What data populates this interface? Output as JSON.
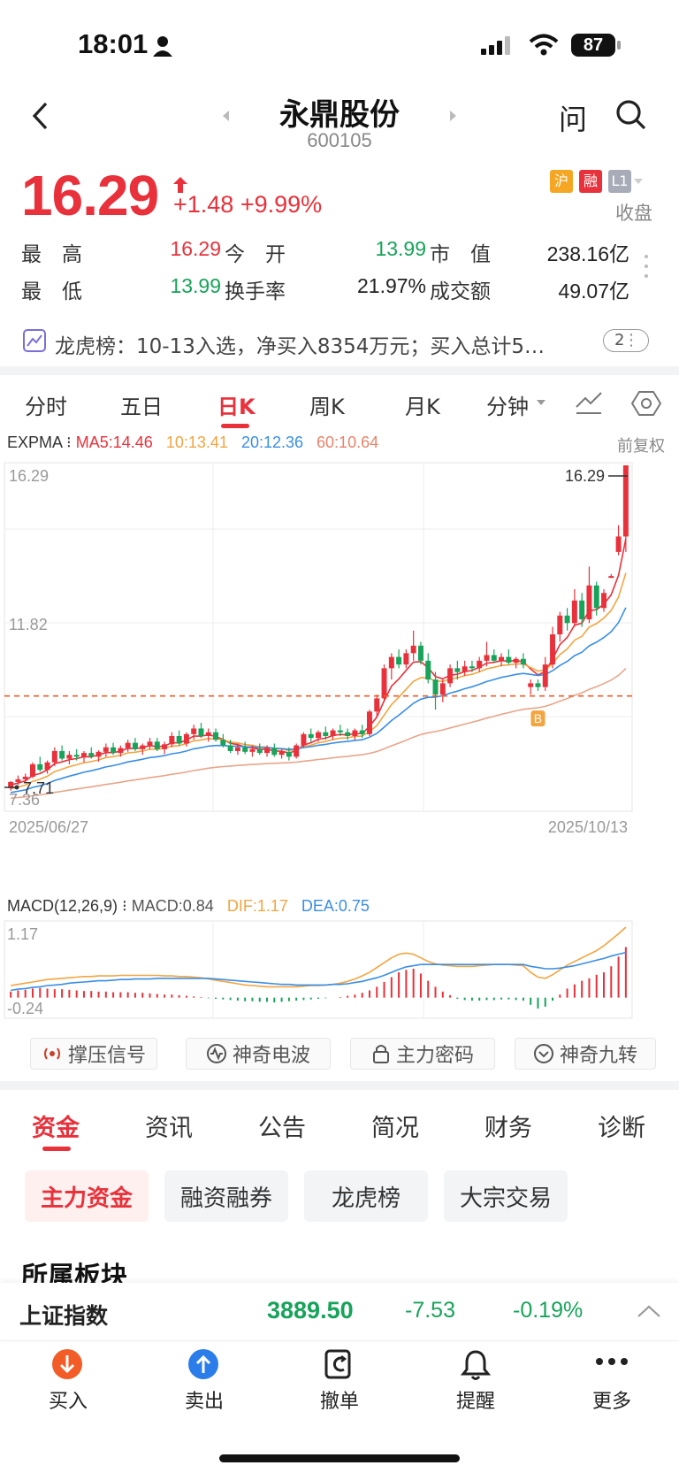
{
  "status": {
    "time": "18:01",
    "battery": "87"
  },
  "header": {
    "title": "永鼎股份",
    "code": "600105",
    "back_icon": "chevron-left-icon",
    "search_icon": "search-icon",
    "ask_label": "问"
  },
  "quote": {
    "price": "16.29",
    "change": "+1.48",
    "change_pct": "+9.99%",
    "badge_sh": "沪",
    "badge_rong": "融",
    "badge_l1": "L1",
    "status": "收盘"
  },
  "stats": [
    {
      "label": "最　高",
      "value": "16.29",
      "color": "red"
    },
    {
      "label": "今　开",
      "value": "13.99",
      "color": "grn"
    },
    {
      "label": "市　值",
      "value": "238.16亿",
      "color": "dark"
    },
    {
      "label": "最　低",
      "value": "13.99",
      "color": "grn"
    },
    {
      "label": "换手率",
      "value": "21.97%",
      "color": "dark"
    },
    {
      "label": "成交额",
      "value": "49.07亿",
      "color": "dark"
    }
  ],
  "lhb": {
    "text": "龙虎榜：10-13入选，净买入8354万元；买入总计5…",
    "count": "2"
  },
  "tabs": [
    "分时",
    "五日",
    "日K",
    "周K",
    "月K",
    "分钟"
  ],
  "active_tab": "日K",
  "expma": {
    "label": "EXPMA",
    "ma5": "MA5:14.46",
    "ma10": "10:13.41",
    "ma20": "20:12.36",
    "ma60": "60:10.64",
    "adjust": "前复权"
  },
  "macd": {
    "label": "MACD(12,26,9)",
    "macd": "MACD:0.84",
    "dif": "DIF:1.17",
    "dea": "DEA:0.75"
  },
  "chart_data": {
    "type": "candlestick",
    "y_axis_labels": [
      "16.29",
      "11.82",
      "7.36"
    ],
    "x_axis_labels": [
      "2025/06/27",
      "2025/10/13"
    ],
    "last_price_label": "16.29",
    "low_label": "7.71",
    "buy_marker": "B",
    "macd_axis_labels": [
      "1.17",
      "-0.24"
    ],
    "ylim": [
      7.36,
      16.29
    ],
    "macd_ylim": [
      -0.24,
      1.17
    ],
    "candles": [
      [
        7.72,
        7.9,
        7.65,
        7.88
      ],
      [
        7.88,
        8.05,
        7.8,
        7.95
      ],
      [
        7.95,
        8.1,
        7.85,
        8.02
      ],
      [
        8.02,
        8.4,
        7.98,
        8.35
      ],
      [
        8.35,
        8.55,
        8.15,
        8.2
      ],
      [
        8.2,
        8.45,
        8.1,
        8.4
      ],
      [
        8.4,
        8.8,
        8.3,
        8.7
      ],
      [
        8.7,
        8.85,
        8.45,
        8.5
      ],
      [
        8.5,
        8.7,
        8.35,
        8.6
      ],
      [
        8.6,
        8.75,
        8.45,
        8.55
      ],
      [
        8.55,
        8.7,
        8.4,
        8.65
      ],
      [
        8.65,
        8.8,
        8.5,
        8.55
      ],
      [
        8.55,
        8.72,
        8.42,
        8.68
      ],
      [
        8.68,
        8.9,
        8.55,
        8.8
      ],
      [
        8.8,
        8.92,
        8.6,
        8.65
      ],
      [
        8.65,
        8.85,
        8.55,
        8.78
      ],
      [
        8.78,
        9.0,
        8.68,
        8.92
      ],
      [
        8.92,
        9.05,
        8.7,
        8.75
      ],
      [
        8.75,
        8.9,
        8.6,
        8.85
      ],
      [
        8.85,
        9.05,
        8.75,
        8.95
      ],
      [
        8.95,
        9.05,
        8.7,
        8.75
      ],
      [
        8.75,
        8.95,
        8.62,
        8.88
      ],
      [
        8.88,
        9.2,
        8.8,
        9.1
      ],
      [
        9.1,
        9.25,
        8.85,
        8.9
      ],
      [
        8.9,
        9.2,
        8.82,
        9.15
      ],
      [
        9.15,
        9.4,
        9.0,
        9.3
      ],
      [
        9.3,
        9.45,
        9.05,
        9.1
      ],
      [
        9.1,
        9.3,
        8.95,
        9.2
      ],
      [
        9.2,
        9.3,
        8.95,
        9.0
      ],
      [
        9.0,
        9.15,
        8.8,
        8.85
      ],
      [
        8.85,
        9.0,
        8.65,
        8.7
      ],
      [
        8.7,
        8.9,
        8.6,
        8.8
      ],
      [
        8.8,
        8.95,
        8.62,
        8.68
      ],
      [
        8.68,
        8.85,
        8.55,
        8.75
      ],
      [
        8.75,
        8.9,
        8.6,
        8.65
      ],
      [
        8.65,
        8.85,
        8.55,
        8.78
      ],
      [
        8.78,
        8.9,
        8.55,
        8.6
      ],
      [
        8.6,
        8.75,
        8.5,
        8.68
      ],
      [
        8.68,
        8.8,
        8.45,
        8.55
      ],
      [
        8.55,
        8.9,
        8.5,
        8.85
      ],
      [
        8.85,
        9.2,
        8.8,
        9.15
      ],
      [
        9.15,
        9.3,
        8.95,
        9.05
      ],
      [
        9.05,
        9.25,
        8.95,
        9.2
      ],
      [
        9.2,
        9.35,
        9.0,
        9.1
      ],
      [
        9.1,
        9.3,
        9.0,
        9.25
      ],
      [
        9.25,
        9.4,
        9.1,
        9.2
      ],
      [
        9.2,
        9.3,
        9.0,
        9.1
      ],
      [
        9.1,
        9.3,
        9.0,
        9.25
      ],
      [
        9.25,
        9.4,
        9.05,
        9.15
      ],
      [
        9.15,
        9.8,
        9.1,
        9.75
      ],
      [
        9.75,
        10.2,
        9.6,
        10.1
      ],
      [
        10.1,
        11.0,
        10.0,
        10.9
      ],
      [
        10.9,
        11.3,
        10.6,
        11.2
      ],
      [
        11.2,
        11.4,
        10.9,
        11.0
      ],
      [
        11.0,
        11.4,
        10.9,
        11.3
      ],
      [
        11.3,
        11.9,
        11.1,
        11.5
      ],
      [
        11.5,
        11.6,
        11.0,
        11.1
      ],
      [
        11.1,
        11.3,
        10.5,
        10.6
      ],
      [
        10.6,
        10.8,
        9.8,
        10.2
      ],
      [
        10.2,
        10.6,
        10.0,
        10.5
      ],
      [
        10.5,
        11.0,
        10.4,
        10.9
      ],
      [
        10.9,
        11.1,
        10.6,
        10.8
      ],
      [
        10.8,
        11.1,
        10.7,
        10.95
      ],
      [
        10.95,
        11.1,
        10.8,
        10.9
      ],
      [
        10.9,
        11.2,
        10.8,
        11.1
      ],
      [
        11.1,
        11.6,
        10.95,
        11.25
      ],
      [
        11.25,
        11.4,
        11.05,
        11.1
      ],
      [
        11.1,
        11.3,
        10.95,
        11.2
      ],
      [
        11.2,
        11.4,
        11.0,
        11.05
      ],
      [
        11.05,
        11.2,
        10.9,
        11.15
      ],
      [
        11.15,
        11.3,
        10.9,
        11.0
      ],
      [
        10.4,
        10.6,
        10.2,
        10.5
      ],
      [
        10.5,
        10.6,
        10.3,
        10.4
      ],
      [
        10.4,
        11.2,
        10.3,
        11.0
      ],
      [
        11.0,
        12.0,
        10.9,
        11.8
      ],
      [
        11.8,
        12.4,
        11.6,
        12.3
      ],
      [
        12.3,
        12.5,
        11.9,
        12.1
      ],
      [
        12.1,
        13.0,
        12.0,
        12.7
      ],
      [
        12.7,
        12.9,
        12.0,
        12.2
      ],
      [
        12.2,
        13.6,
        12.1,
        13.1
      ],
      [
        13.1,
        13.2,
        12.3,
        12.5
      ],
      [
        12.5,
        13.0,
        12.4,
        12.9
      ],
      [
        13.3,
        13.4,
        13.3,
        13.35
      ],
      [
        13.99,
        14.7,
        13.9,
        14.4
      ],
      [
        14.4,
        16.29,
        13.99,
        16.29
      ]
    ],
    "macd_hist": [
      0.1,
      0.12,
      0.13,
      0.15,
      0.16,
      0.15,
      0.14,
      0.14,
      0.13,
      0.12,
      0.11,
      0.11,
      0.1,
      0.1,
      0.09,
      0.09,
      0.09,
      0.08,
      0.08,
      0.07,
      0.06,
      0.05,
      0.05,
      0.04,
      0.03,
      0.02,
      0.01,
      -0.01,
      -0.02,
      -0.03,
      -0.04,
      -0.05,
      -0.06,
      -0.06,
      -0.07,
      -0.07,
      -0.08,
      -0.07,
      -0.06,
      -0.05,
      -0.04,
      -0.03,
      -0.02,
      -0.01,
      0.0,
      0.01,
      0.03,
      0.05,
      0.08,
      0.12,
      0.18,
      0.26,
      0.34,
      0.42,
      0.46,
      0.48,
      0.4,
      0.28,
      0.18,
      0.1,
      0.04,
      -0.02,
      -0.04,
      -0.05,
      -0.05,
      -0.04,
      -0.04,
      -0.03,
      -0.03,
      -0.04,
      -0.05,
      -0.12,
      -0.18,
      -0.15,
      -0.05,
      0.05,
      0.15,
      0.22,
      0.28,
      0.32,
      0.38,
      0.42,
      0.52,
      0.68,
      0.84
    ],
    "dif_line": [
      0.2,
      0.22,
      0.24,
      0.26,
      0.28,
      0.3,
      0.31,
      0.32,
      0.33,
      0.34,
      0.35,
      0.35,
      0.36,
      0.36,
      0.36,
      0.37,
      0.37,
      0.37,
      0.37,
      0.37,
      0.37,
      0.36,
      0.36,
      0.35,
      0.35,
      0.34,
      0.33,
      0.31,
      0.29,
      0.27,
      0.25,
      0.23,
      0.21,
      0.2,
      0.19,
      0.18,
      0.18,
      0.18,
      0.18,
      0.18,
      0.19,
      0.2,
      0.2,
      0.21,
      0.22,
      0.24,
      0.27,
      0.31,
      0.36,
      0.42,
      0.5,
      0.58,
      0.66,
      0.72,
      0.74,
      0.72,
      0.66,
      0.6,
      0.56,
      0.54,
      0.53,
      0.52,
      0.52,
      0.52,
      0.53,
      0.54,
      0.55,
      0.55,
      0.55,
      0.54,
      0.53,
      0.42,
      0.34,
      0.32,
      0.38,
      0.46,
      0.54,
      0.6,
      0.66,
      0.72,
      0.78,
      0.86,
      0.96,
      1.06,
      1.17
    ],
    "dea_line": [
      0.12,
      0.14,
      0.15,
      0.17,
      0.18,
      0.2,
      0.21,
      0.22,
      0.24,
      0.25,
      0.26,
      0.27,
      0.28,
      0.28,
      0.29,
      0.3,
      0.3,
      0.31,
      0.31,
      0.31,
      0.32,
      0.32,
      0.32,
      0.32,
      0.32,
      0.32,
      0.32,
      0.32,
      0.31,
      0.3,
      0.29,
      0.28,
      0.27,
      0.26,
      0.25,
      0.24,
      0.23,
      0.22,
      0.22,
      0.21,
      0.21,
      0.21,
      0.21,
      0.21,
      0.22,
      0.22,
      0.23,
      0.25,
      0.27,
      0.3,
      0.33,
      0.37,
      0.42,
      0.47,
      0.51,
      0.53,
      0.55,
      0.55,
      0.55,
      0.55,
      0.55,
      0.55,
      0.55,
      0.55,
      0.55,
      0.55,
      0.55,
      0.55,
      0.55,
      0.55,
      0.55,
      0.52,
      0.5,
      0.48,
      0.48,
      0.49,
      0.51,
      0.53,
      0.56,
      0.59,
      0.62,
      0.65,
      0.69,
      0.72,
      0.75
    ]
  },
  "signals": [
    {
      "label": "撑压信号",
      "icon": "broadcast-icon"
    },
    {
      "label": "神奇电波",
      "icon": "wave-icon"
    },
    {
      "label": "主力密码",
      "icon": "lock-icon"
    },
    {
      "label": "神奇九转",
      "icon": "chevron-circle-icon"
    }
  ],
  "info_tabs": [
    "资金",
    "资讯",
    "公告",
    "简况",
    "财务",
    "诊断"
  ],
  "active_info_tab": "资金",
  "sub_chips": [
    "主力资金",
    "融资融券",
    "龙虎榜",
    "大宗交易"
  ],
  "section_title": "所属板块",
  "index_bar": {
    "name": "上证指数",
    "value": "3889.50",
    "change": "-7.53",
    "pct": "-0.19%"
  },
  "bottom_nav": [
    {
      "label": "买入",
      "icon": "buy-arrow-icon"
    },
    {
      "label": "卖出",
      "icon": "sell-arrow-icon"
    },
    {
      "label": "撤单",
      "icon": "cancel-order-icon"
    },
    {
      "label": "提醒",
      "icon": "bell-icon"
    },
    {
      "label": "更多",
      "icon": "more-dots-icon"
    }
  ]
}
